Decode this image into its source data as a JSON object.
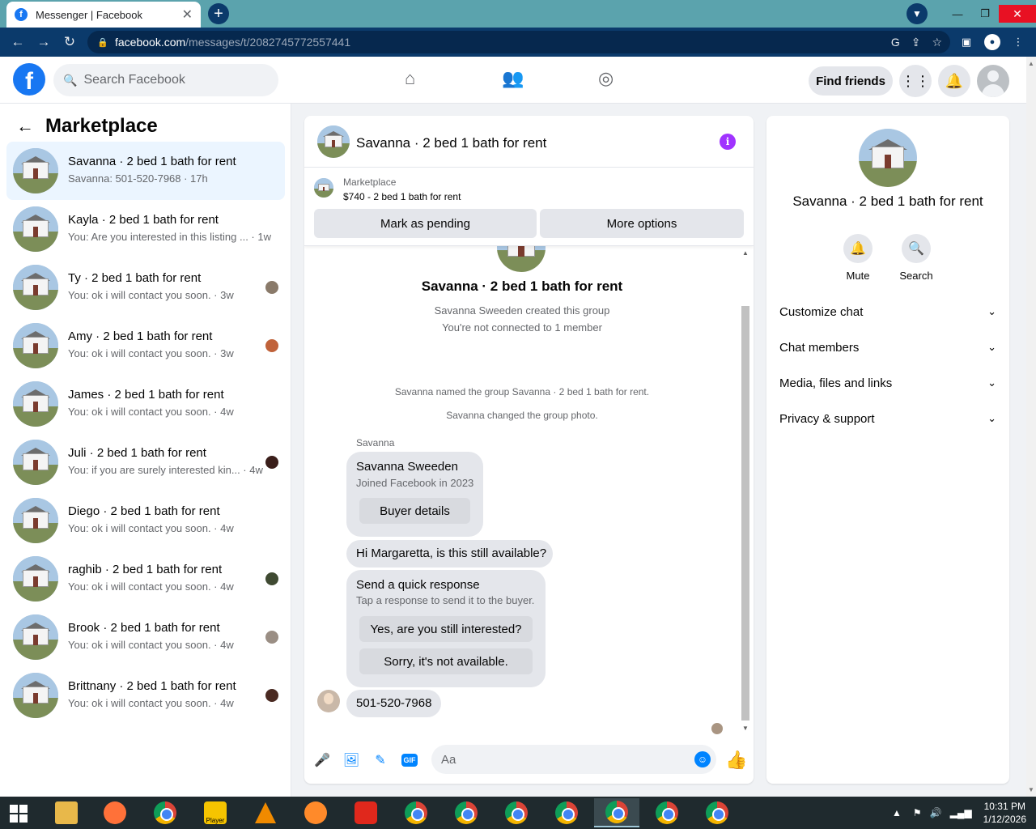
{
  "browser": {
    "tab_title": "Messenger | Facebook",
    "url_host": "facebook.com",
    "url_path": "/messages/t/2082745772557441"
  },
  "fb": {
    "search_placeholder": "Search Facebook",
    "find_friends": "Find friends"
  },
  "sidebar": {
    "title": "Marketplace",
    "conversations": [
      {
        "name": "Savanna · 2 bed 1 bath for rent",
        "snippet": "Savanna: 501-520-7968 · 17h",
        "active": true
      },
      {
        "name": "Kayla · 2 bed 1 bath for rent",
        "snippet": "You: Are you interested in this listing ... · 1w"
      },
      {
        "name": "Ty · 2 bed 1 bath for rent",
        "snippet": "You: ok i will contact you soon. · 3w"
      },
      {
        "name": "Amy · 2 bed 1 bath for rent",
        "snippet": "You: ok i will contact you soon. · 3w"
      },
      {
        "name": "James · 2 bed 1 bath for rent",
        "snippet": "You: ok i will contact you soon. · 4w"
      },
      {
        "name": "Juli · 2 bed 1 bath for rent",
        "snippet": "You: if you are surely interested kin... · 4w"
      },
      {
        "name": "Diego · 2 bed 1 bath for rent",
        "snippet": "You: ok i will contact you soon. · 4w"
      },
      {
        "name": "raghib · 2 bed 1 bath for rent",
        "snippet": "You: ok i will contact you soon. · 4w"
      },
      {
        "name": "Brook · 2 bed 1 bath for rent",
        "snippet": "You: ok i will contact you soon. · 4w"
      },
      {
        "name": "Brittnany · 2 bed 1 bath for rent",
        "snippet": "You: ok i will contact you soon. · 4w"
      }
    ]
  },
  "chat": {
    "title": "Savanna · 2 bed 1 bath for rent",
    "marketplace_label": "Marketplace",
    "listing_price": "$740 - 2 bed 1 bath for rent",
    "mark_pending": "Mark as pending",
    "more_options": "More options",
    "group_title": "Savanna · 2 bed 1 bath for rent",
    "created": "Savanna Sweeden created this group",
    "not_connected": "You're not connected to 1 member",
    "named": "Savanna named the group Savanna · 2 bed 1 bath for rent.",
    "changed_photo": "Savanna changed the group photo.",
    "sender": "Savanna",
    "card_name": "Savanna Sweeden",
    "card_joined": "Joined Facebook in 2023",
    "buyer_details": "Buyer details",
    "msg1": "Hi Margaretta, is this still available?",
    "quick_title": "Send a quick response",
    "quick_sub": "Tap a response to send it to the buyer.",
    "quick_yes": "Yes, are you still interested?",
    "quick_no": "Sorry, it's not available.",
    "msg2": "501-520-7968",
    "composer_placeholder": "Aa",
    "gif": "GIF"
  },
  "info": {
    "title": "Savanna · 2 bed 1 bath for rent",
    "mute": "Mute",
    "search": "Search",
    "rows": [
      "Customize chat",
      "Chat members",
      "Media, files and links",
      "Privacy & support"
    ]
  },
  "taskbar": {
    "time": "10:31 PM",
    "date": "1/12/2026",
    "player_label": "Player"
  }
}
